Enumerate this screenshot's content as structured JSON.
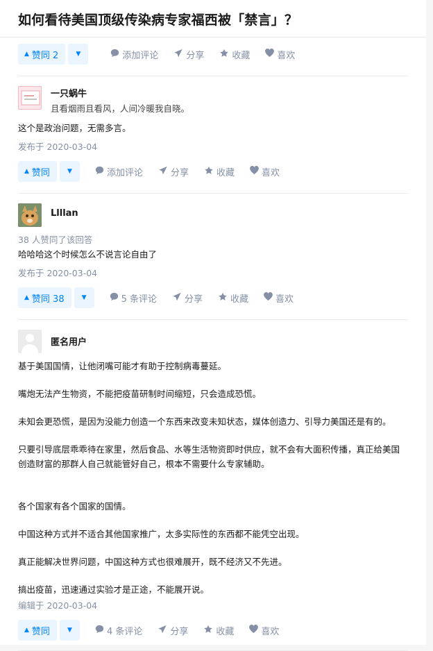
{
  "question": {
    "title": "如何看待美国顶级传染病专家福西被「禁言」？"
  },
  "top_actions": {
    "vote_up": "赞同 2",
    "comment": "添加评论",
    "share": "分享",
    "collect": "收藏",
    "like": "喜欢"
  },
  "answers": [
    {
      "author": "一只蜗牛",
      "headline": "且看烟雨且看风，人间冷暖我自晓。",
      "paragraphs": [
        "这个是政治问题，无需多言。"
      ],
      "date": "发布于 2020-03-04",
      "vote_up": "赞同",
      "comment": "添加评论",
      "share": "分享",
      "collect": "收藏",
      "like": "喜欢"
    },
    {
      "author": "Llllan",
      "upvote_summary": "38 人赞同了该回答",
      "paragraphs": [
        "哈哈哈这个时候怎么不说言论自由了"
      ],
      "date": "发布于 2020-03-04",
      "vote_up": "赞同 38",
      "comment": "5 条评论",
      "share": "分享",
      "collect": "收藏",
      "like": "喜欢"
    },
    {
      "author": "匿名用户",
      "paragraphs": [
        "基于美国国情，让他闭嘴可能才有助于控制病毒蔓延。",
        "嘴炮无法产生物资，不能把疫苗研制时间缩短，只会造成恐慌。",
        "未知会更恐慌，是因为没能力创造一个东西来改变未知状态，媒体创造力、引导力美国还是有的。",
        "只要引导底层乖乖待在家里，然后食品、水等生活物资即时供应，就不会有大面积传播，真正给美国创造财富的那群人自己就能管好自己，根本不需要什么专家辅助。",
        "各个国家有各个国家的国情。",
        "中国这种方式并不适合其他国家推广，太多实际性的东西都不能凭空出现。",
        "真正能解决世界问题，中国这种方式也很难展开，既不经济又不先进。",
        "搞出疫苗，迅速通过实验才是正途，不能展开说。"
      ],
      "date": "编辑于 2020-03-04",
      "vote_up": "赞同",
      "comment": "4 条评论",
      "share": "分享",
      "collect": "收藏",
      "like": "喜欢"
    }
  ],
  "colors": {
    "accent": "#0084ff",
    "accent_bg": "#ebf5ff",
    "meta": "#8590a6"
  }
}
